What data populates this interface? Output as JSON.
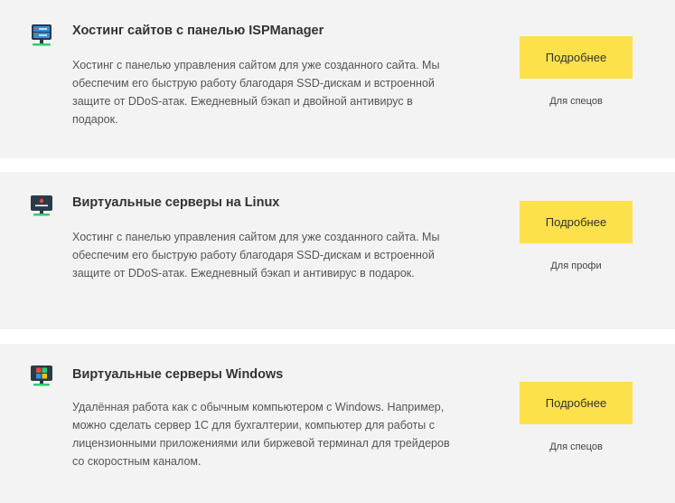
{
  "cards": [
    {
      "title": "Хостинг сайтов с панелью ISPManager",
      "description": "Хостинг с панелью управления сайтом для уже созданного сайта. Мы обеспечим его быструю работу благодаря SSD-дискам и встроенной защите от DDoS-атак. Ежедневный бэкап и двойной антивирус в подарок.",
      "button_label": "Подробнее",
      "audience": "Для спецов",
      "icon": "server-rack-icon"
    },
    {
      "title": "Виртуальные серверы на Linux",
      "description": "Хостинг с панелью управления сайтом для уже созданного сайта. Мы обеспечим его быструю работу благодаря SSD-дискам и встроенной защите от DDoS-атак. Ежедневный бэкап и антивирус в подарок.",
      "button_label": "Подробнее",
      "audience": "Для профи",
      "icon": "linux-monitor-icon"
    },
    {
      "title": "Виртуальные серверы Windows",
      "description": "Удалённая работа как с обычным компьютером с Windows. Например, можно сделать сервер 1С для бухгалтерии, компьютер для работы с лицензионными приложениями или биржевой терминал для трейдеров со скоростным каналом.",
      "button_label": "Подробнее",
      "audience": "Для спецов",
      "icon": "windows-monitor-icon"
    }
  ],
  "colors": {
    "card_background": "#f3f3f3",
    "button_background": "#fde14a",
    "icon_dark": "#2b3a4a",
    "icon_blue": "#2f8fd8",
    "icon_green": "#2ecc71",
    "icon_red": "#e74c3c"
  }
}
